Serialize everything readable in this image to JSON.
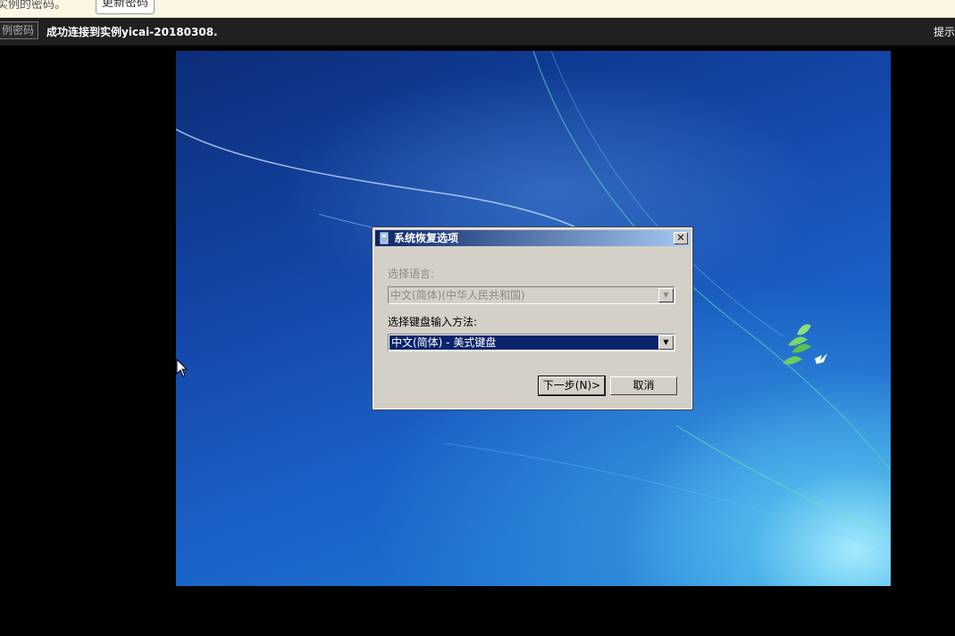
{
  "topbar": {
    "hint_text": "实例的密码。",
    "hint_button": "更新密码"
  },
  "status": {
    "password_button": "例密码",
    "message": "成功连接到实例yicai-20180308.",
    "tip": "提示"
  },
  "dialog": {
    "title": "系统恢复选项",
    "close_label": "✕",
    "language_label": "选择语言:",
    "language_value": "中文(简体)(中华人民共和国)",
    "keyboard_label": "选择键盘输入方法:",
    "keyboard_value": "中文(简体) - 美式键盘",
    "next_button": "下一步(N)>",
    "cancel_button": "取消"
  },
  "colors": {
    "title_start": "#0a246a",
    "title_end": "#a6caf0",
    "dialog_face": "#d4d0c8"
  }
}
